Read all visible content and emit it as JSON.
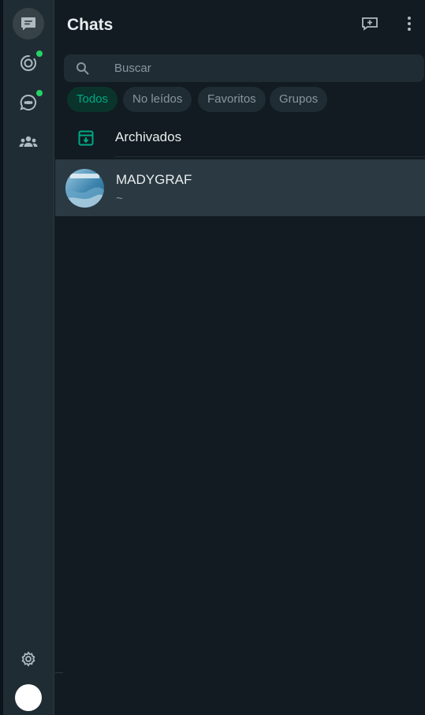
{
  "header": {
    "title": "Chats",
    "new_chat_icon": "new-chat-icon",
    "menu_icon": "kebab-menu-icon"
  },
  "rail": {
    "items": [
      {
        "name": "chats",
        "icon": "chat-bubble-icon",
        "active": true
      },
      {
        "name": "status",
        "icon": "status-ring-icon",
        "badge": true
      },
      {
        "name": "channels",
        "icon": "channels-icon",
        "badge": true
      },
      {
        "name": "communities",
        "icon": "communities-icon"
      }
    ],
    "settings_icon": "gear-icon"
  },
  "search": {
    "placeholder": "Buscar",
    "value": ""
  },
  "filters": [
    {
      "label": "Todos",
      "active": true
    },
    {
      "label": "No leídos",
      "active": false
    },
    {
      "label": "Favoritos",
      "active": false
    },
    {
      "label": "Grupos",
      "active": false
    }
  ],
  "archived": {
    "label": "Archivados"
  },
  "chats": [
    {
      "name": "MADYGRAF",
      "preview": "~",
      "selected": true
    }
  ],
  "colors": {
    "accent": "#00a884",
    "badge": "#25d366",
    "background": "#111b21",
    "panel": "#202c33",
    "selected_row": "#2a3942"
  }
}
